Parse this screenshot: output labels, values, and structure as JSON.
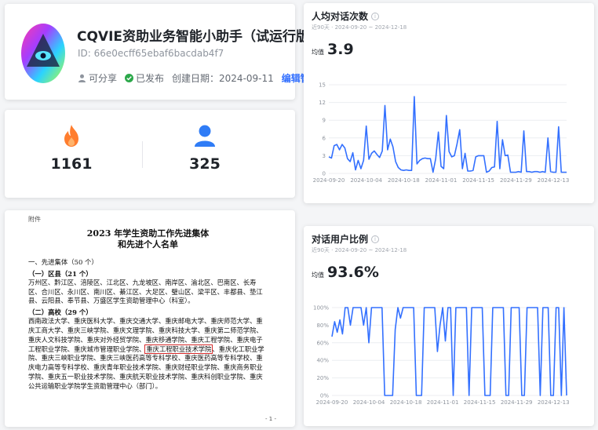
{
  "profile": {
    "name": "CQVIE资助业务智能小助手（试运行版）",
    "id": "ID: 66e0ecff65ebaf6bacdab4f7",
    "shareable": "可分享",
    "published": "已发布",
    "created": "创建日期：2024-09-11",
    "edit": "编辑智能体"
  },
  "stats": {
    "hot_count": "1161",
    "user_count": "325"
  },
  "document": {
    "appendix": "附件",
    "title_line1": "2023 年学生资助工作先进集体",
    "title_line2": "和先进个人名单",
    "section1": "一、先进集体（50 个）",
    "sub1": "（一）区县（21 个）",
    "para1": "万州区、黔江区、涪陵区、江北区、九龙坡区、南岸区、渝北区、巴南区、长寿区、合川区、永川区、南川区、綦江区、大足区、璧山区、梁平区、丰都县、垫江县、云阳县、奉节县、万盛区学生资助管理中心（科室）。",
    "sub2": "（二）高校（29 个）",
    "para2_a": "西南政法大学、重庆医科大学、重庆交通大学、重庆邮电大学、重庆师范大学、重庆工商大学、重庆三峡学院、重庆文理学院、重庆科技大学、重庆第二师范学院、重庆人文科技学院、重庆对外经贸学院、重庆移通学院、重庆工程学院、重庆电子工程职业学院、重庆城市管理职业学院、",
    "para2_hl": "重庆工程职业技术学院",
    "para2_b": "、重庆化工职业学院、重庆三峡职业学院、重庆三峡医药高等专科学校、重庆医药高等专科学校、重庆电力高等专科学校、重庆青年职业技术学院、重庆财经职业学院、重庆商务职业学院、重庆五一职业技术学院、重庆航天职业技术学院、重庆科创职业学院、重庆公共运输职业学院学生资助管理中心（部门）。",
    "page": "- 1 -"
  },
  "chart1": {
    "title": "人均对话次数",
    "range": "近90天 · 2024-09-20 ~ 2024-12-18",
    "avg_label": "均值",
    "avg_value": "3.9"
  },
  "chart2": {
    "title": "对话用户比例",
    "range": "近90天 · 2024-09-20 ~ 2024-12-18",
    "avg_label": "均值",
    "avg_value": "93.6%"
  },
  "colors": {
    "line": "#3370ff",
    "accent": "#3370ff",
    "fire": "#ff7d2e",
    "user": "#2f7cf6",
    "published": "#2ca84a"
  },
  "chart_data": [
    {
      "type": "line",
      "title": "人均对话次数",
      "xlabel": "",
      "ylabel": "",
      "x_ticks": [
        "2024-09-20",
        "2024-10-04",
        "2024-10-18",
        "2024-11-01",
        "2024-11-15",
        "2024-11-29",
        "2024-12-13"
      ],
      "yticks": [
        "0",
        "3",
        "6",
        "9",
        "12",
        "15"
      ],
      "ylim": [
        0,
        15
      ],
      "grid": true,
      "x_start": "2024-09-20",
      "values": [
        2.8,
        2.6,
        4.7,
        4.9,
        4.0,
        4.9,
        4.3,
        2.5,
        2.0,
        3.5,
        0.6,
        2.2,
        0.8,
        2.2,
        8.0,
        2.4,
        3.4,
        3.8,
        3.2,
        2.7,
        3.8,
        11.5,
        4.0,
        5.8,
        4.5,
        2.0,
        1.0,
        0.6,
        0.5,
        0.6,
        0.5,
        0.5,
        13.0,
        1.6,
        2.2,
        2.5,
        2.6,
        2.5,
        2.5,
        0.2,
        2.5,
        7.0,
        1.2,
        0.8,
        9.8,
        3.7,
        2.8,
        3.0,
        5.0,
        7.4,
        0.8,
        3.4,
        0.4,
        0.4,
        0.5,
        2.8,
        3.0,
        3.0,
        3.0,
        0.2,
        0.4,
        1.0,
        1.1,
        8.8,
        0.8,
        5.7,
        3.0,
        3.1,
        0.2,
        0.2,
        0.2,
        0.3,
        0.2,
        7.2,
        0.3,
        0.3,
        0.2,
        0.3,
        0.3,
        0.2,
        0.3,
        0.2,
        6.0,
        0.3,
        0.2,
        0.2,
        7.9,
        0.2,
        0.2,
        0.2
      ]
    },
    {
      "type": "line",
      "title": "对话用户比例",
      "xlabel": "",
      "ylabel": "",
      "x_ticks": [
        "2024-09-20",
        "2024-10-04",
        "2024-10-18",
        "2024-11-01",
        "2024-11-15",
        "2024-11-29",
        "2024-12-13"
      ],
      "yticks": [
        "0%",
        "20%",
        "40%",
        "60%",
        "80%",
        "100%"
      ],
      "ylim": [
        0,
        100
      ],
      "grid": true,
      "x_start": "2024-09-20",
      "values": [
        67,
        84,
        72,
        86,
        70,
        100,
        100,
        80,
        100,
        100,
        100,
        100,
        80,
        100,
        60,
        100,
        100,
        100,
        100,
        100,
        0,
        0,
        0,
        0,
        75,
        100,
        88,
        100,
        100,
        100,
        100,
        100,
        0,
        0,
        0,
        100,
        100,
        100,
        100,
        100,
        50,
        80,
        100,
        62,
        100,
        100,
        0,
        100,
        100,
        100,
        100,
        100,
        0,
        100,
        100,
        100,
        100,
        100,
        0,
        0,
        0,
        100,
        100,
        100,
        100,
        100,
        0,
        0,
        100,
        100,
        100,
        100,
        0,
        0,
        100,
        100,
        100,
        100,
        100,
        0,
        100,
        100,
        100,
        0,
        0,
        100,
        100,
        0,
        100,
        0
      ]
    }
  ]
}
